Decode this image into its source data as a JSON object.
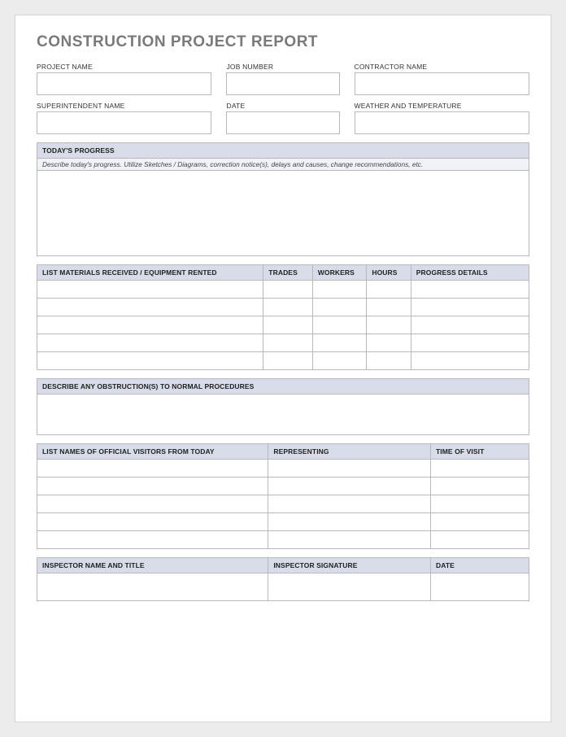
{
  "title": "CONSTRUCTION PROJECT REPORT",
  "row1": {
    "project_name": {
      "label": "PROJECT NAME",
      "value": ""
    },
    "job_number": {
      "label": "JOB NUMBER",
      "value": ""
    },
    "contractor_name": {
      "label": "CONTRACTOR NAME",
      "value": ""
    }
  },
  "row2": {
    "superintendent_name": {
      "label": "SUPERINTENDENT NAME",
      "value": ""
    },
    "date": {
      "label": "DATE",
      "value": ""
    },
    "weather": {
      "label": "WEATHER AND TEMPERATURE",
      "value": ""
    }
  },
  "progress": {
    "header": "TODAY'S PROGRESS",
    "instruction": "Describe today's progress.  Utilize Sketches / Diagrams, correction notice(s), delays and causes, change recommendations, etc.",
    "value": ""
  },
  "materials": {
    "headers": {
      "col1": "LIST MATERIALS RECEIVED / EQUIPMENT RENTED",
      "col2": "TRADES",
      "col3": "WORKERS",
      "col4": "HOURS",
      "col5": "PROGRESS DETAILS"
    },
    "rows": [
      {
        "c1": "",
        "c2": "",
        "c3": "",
        "c4": "",
        "c5": ""
      },
      {
        "c1": "",
        "c2": "",
        "c3": "",
        "c4": "",
        "c5": ""
      },
      {
        "c1": "",
        "c2": "",
        "c3": "",
        "c4": "",
        "c5": ""
      },
      {
        "c1": "",
        "c2": "",
        "c3": "",
        "c4": "",
        "c5": ""
      },
      {
        "c1": "",
        "c2": "",
        "c3": "",
        "c4": "",
        "c5": ""
      }
    ]
  },
  "obstructions": {
    "header": "DESCRIBE ANY OBSTRUCTION(S) TO NORMAL PROCEDURES",
    "value": ""
  },
  "visitors": {
    "headers": {
      "col1": "LIST NAMES OF OFFICIAL VISITORS FROM TODAY",
      "col2": "REPRESENTING",
      "col3": "TIME OF VISIT"
    },
    "rows": [
      {
        "c1": "",
        "c2": "",
        "c3": ""
      },
      {
        "c1": "",
        "c2": "",
        "c3": ""
      },
      {
        "c1": "",
        "c2": "",
        "c3": ""
      },
      {
        "c1": "",
        "c2": "",
        "c3": ""
      },
      {
        "c1": "",
        "c2": "",
        "c3": ""
      }
    ]
  },
  "inspector": {
    "headers": {
      "col1": "INSPECTOR NAME AND TITLE",
      "col2": "INSPECTOR SIGNATURE",
      "col3": "DATE"
    },
    "row": {
      "c1": "",
      "c2": "",
      "c3": ""
    }
  }
}
